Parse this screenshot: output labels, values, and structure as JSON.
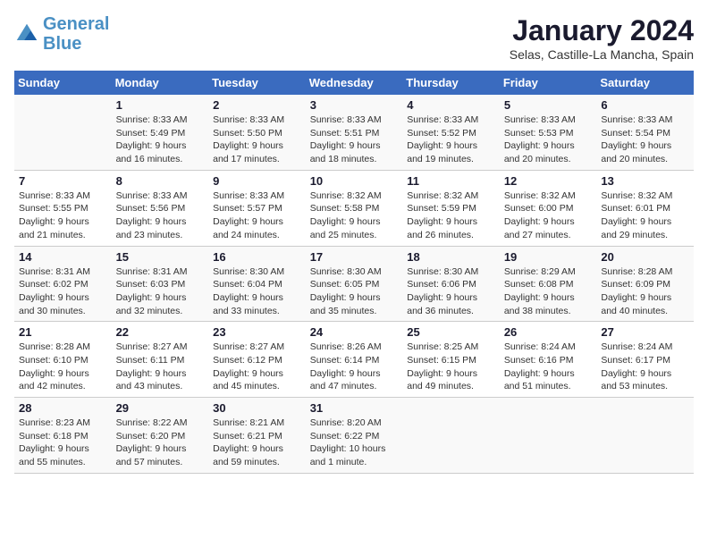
{
  "header": {
    "logo_line1": "General",
    "logo_line2": "Blue",
    "main_title": "January 2024",
    "subtitle": "Selas, Castille-La Mancha, Spain"
  },
  "calendar": {
    "days_of_week": [
      "Sunday",
      "Monday",
      "Tuesday",
      "Wednesday",
      "Thursday",
      "Friday",
      "Saturday"
    ],
    "weeks": [
      [
        {
          "day": "",
          "info": ""
        },
        {
          "day": "1",
          "info": "Sunrise: 8:33 AM\nSunset: 5:49 PM\nDaylight: 9 hours\nand 16 minutes."
        },
        {
          "day": "2",
          "info": "Sunrise: 8:33 AM\nSunset: 5:50 PM\nDaylight: 9 hours\nand 17 minutes."
        },
        {
          "day": "3",
          "info": "Sunrise: 8:33 AM\nSunset: 5:51 PM\nDaylight: 9 hours\nand 18 minutes."
        },
        {
          "day": "4",
          "info": "Sunrise: 8:33 AM\nSunset: 5:52 PM\nDaylight: 9 hours\nand 19 minutes."
        },
        {
          "day": "5",
          "info": "Sunrise: 8:33 AM\nSunset: 5:53 PM\nDaylight: 9 hours\nand 20 minutes."
        },
        {
          "day": "6",
          "info": "Sunrise: 8:33 AM\nSunset: 5:54 PM\nDaylight: 9 hours\nand 20 minutes."
        }
      ],
      [
        {
          "day": "7",
          "info": "Sunrise: 8:33 AM\nSunset: 5:55 PM\nDaylight: 9 hours\nand 21 minutes."
        },
        {
          "day": "8",
          "info": "Sunrise: 8:33 AM\nSunset: 5:56 PM\nDaylight: 9 hours\nand 23 minutes."
        },
        {
          "day": "9",
          "info": "Sunrise: 8:33 AM\nSunset: 5:57 PM\nDaylight: 9 hours\nand 24 minutes."
        },
        {
          "day": "10",
          "info": "Sunrise: 8:32 AM\nSunset: 5:58 PM\nDaylight: 9 hours\nand 25 minutes."
        },
        {
          "day": "11",
          "info": "Sunrise: 8:32 AM\nSunset: 5:59 PM\nDaylight: 9 hours\nand 26 minutes."
        },
        {
          "day": "12",
          "info": "Sunrise: 8:32 AM\nSunset: 6:00 PM\nDaylight: 9 hours\nand 27 minutes."
        },
        {
          "day": "13",
          "info": "Sunrise: 8:32 AM\nSunset: 6:01 PM\nDaylight: 9 hours\nand 29 minutes."
        }
      ],
      [
        {
          "day": "14",
          "info": "Sunrise: 8:31 AM\nSunset: 6:02 PM\nDaylight: 9 hours\nand 30 minutes."
        },
        {
          "day": "15",
          "info": "Sunrise: 8:31 AM\nSunset: 6:03 PM\nDaylight: 9 hours\nand 32 minutes."
        },
        {
          "day": "16",
          "info": "Sunrise: 8:30 AM\nSunset: 6:04 PM\nDaylight: 9 hours\nand 33 minutes."
        },
        {
          "day": "17",
          "info": "Sunrise: 8:30 AM\nSunset: 6:05 PM\nDaylight: 9 hours\nand 35 minutes."
        },
        {
          "day": "18",
          "info": "Sunrise: 8:30 AM\nSunset: 6:06 PM\nDaylight: 9 hours\nand 36 minutes."
        },
        {
          "day": "19",
          "info": "Sunrise: 8:29 AM\nSunset: 6:08 PM\nDaylight: 9 hours\nand 38 minutes."
        },
        {
          "day": "20",
          "info": "Sunrise: 8:28 AM\nSunset: 6:09 PM\nDaylight: 9 hours\nand 40 minutes."
        }
      ],
      [
        {
          "day": "21",
          "info": "Sunrise: 8:28 AM\nSunset: 6:10 PM\nDaylight: 9 hours\nand 42 minutes."
        },
        {
          "day": "22",
          "info": "Sunrise: 8:27 AM\nSunset: 6:11 PM\nDaylight: 9 hours\nand 43 minutes."
        },
        {
          "day": "23",
          "info": "Sunrise: 8:27 AM\nSunset: 6:12 PM\nDaylight: 9 hours\nand 45 minutes."
        },
        {
          "day": "24",
          "info": "Sunrise: 8:26 AM\nSunset: 6:14 PM\nDaylight: 9 hours\nand 47 minutes."
        },
        {
          "day": "25",
          "info": "Sunrise: 8:25 AM\nSunset: 6:15 PM\nDaylight: 9 hours\nand 49 minutes."
        },
        {
          "day": "26",
          "info": "Sunrise: 8:24 AM\nSunset: 6:16 PM\nDaylight: 9 hours\nand 51 minutes."
        },
        {
          "day": "27",
          "info": "Sunrise: 8:24 AM\nSunset: 6:17 PM\nDaylight: 9 hours\nand 53 minutes."
        }
      ],
      [
        {
          "day": "28",
          "info": "Sunrise: 8:23 AM\nSunset: 6:18 PM\nDaylight: 9 hours\nand 55 minutes."
        },
        {
          "day": "29",
          "info": "Sunrise: 8:22 AM\nSunset: 6:20 PM\nDaylight: 9 hours\nand 57 minutes."
        },
        {
          "day": "30",
          "info": "Sunrise: 8:21 AM\nSunset: 6:21 PM\nDaylight: 9 hours\nand 59 minutes."
        },
        {
          "day": "31",
          "info": "Sunrise: 8:20 AM\nSunset: 6:22 PM\nDaylight: 10 hours\nand 1 minute."
        },
        {
          "day": "",
          "info": ""
        },
        {
          "day": "",
          "info": ""
        },
        {
          "day": "",
          "info": ""
        }
      ]
    ]
  }
}
